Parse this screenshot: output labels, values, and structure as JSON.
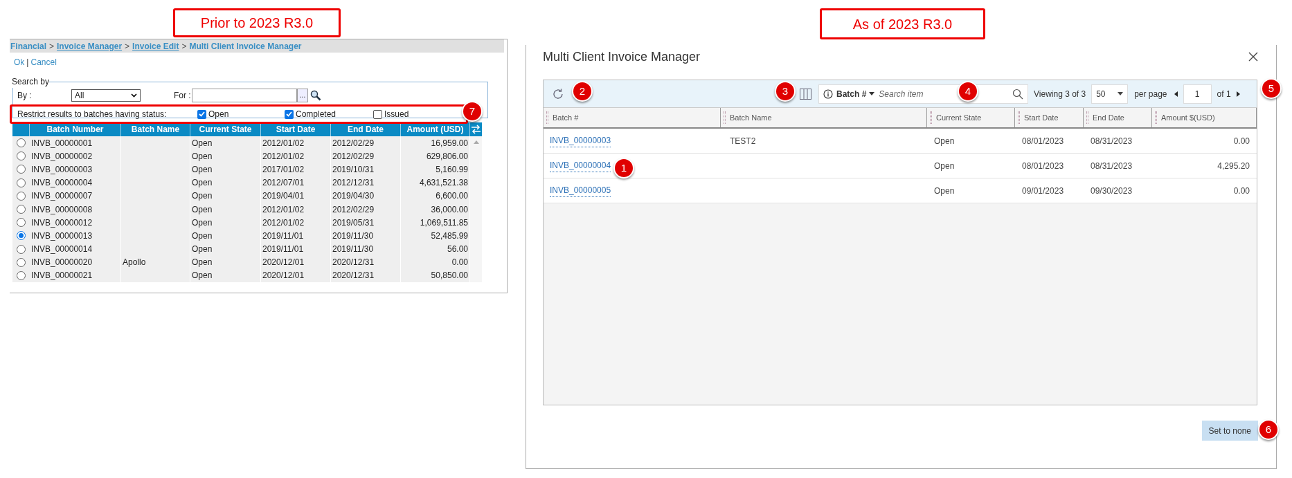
{
  "callouts": [
    {
      "label": "Prior to 2023 R3.0"
    },
    {
      "label": "As of 2023 R3.0"
    }
  ],
  "old_screen": {
    "breadcrumb": [
      {
        "kind": "crumb",
        "label": "Financial",
        "underlined": false
      },
      {
        "kind": "separator",
        "label": ">"
      },
      {
        "kind": "crumb",
        "label": "Invoice Manager",
        "underlined": true
      },
      {
        "kind": "separator",
        "label": ">"
      },
      {
        "kind": "crumb",
        "label": "Invoice Edit",
        "underlined": true
      },
      {
        "kind": "separator",
        "label": ">"
      },
      {
        "kind": "crumb",
        "label": "Multi Client Invoice Manager",
        "underlined": false
      }
    ],
    "actions": [
      {
        "kind": "link",
        "label": "Ok"
      },
      {
        "kind": "separator",
        "label": "|"
      },
      {
        "kind": "link",
        "label": "Cancel"
      }
    ],
    "search_by": {
      "legend": "Search by",
      "by_label": "By :",
      "by_value": "All",
      "for_label": "For :",
      "browse_button": "...",
      "status_label": "Restrict results to batches having status:",
      "statuses": [
        {
          "label": "Open",
          "checked": true
        },
        {
          "label": "Completed",
          "checked": true
        },
        {
          "label": "Issued",
          "checked": false
        }
      ]
    },
    "table": {
      "columns": [
        "Batch Number",
        "Batch Name",
        "Current State",
        "Start Date",
        "End Date",
        "Amount (USD)"
      ],
      "rows": [
        {
          "selected": false,
          "cells": [
            "INVB_00000001",
            "",
            "Open",
            "2012/01/02",
            "2012/02/29",
            "16,959.00"
          ]
        },
        {
          "selected": false,
          "cells": [
            "INVB_00000002",
            "",
            "Open",
            "2012/01/02",
            "2012/02/29",
            "629,806.00"
          ]
        },
        {
          "selected": false,
          "cells": [
            "INVB_00000003",
            "",
            "Open",
            "2017/01/02",
            "2019/10/31",
            "5,160.99"
          ]
        },
        {
          "selected": false,
          "cells": [
            "INVB_00000004",
            "",
            "Open",
            "2012/07/01",
            "2012/12/31",
            "4,631,521.38"
          ]
        },
        {
          "selected": false,
          "cells": [
            "INVB_00000007",
            "",
            "Open",
            "2019/04/01",
            "2019/04/30",
            "6,600.00"
          ]
        },
        {
          "selected": false,
          "cells": [
            "INVB_00000008",
            "",
            "Open",
            "2012/01/02",
            "2012/02/29",
            "36,000.00"
          ]
        },
        {
          "selected": false,
          "cells": [
            "INVB_00000012",
            "",
            "Open",
            "2012/01/02",
            "2019/05/31",
            "1,069,511.85"
          ]
        },
        {
          "selected": true,
          "cells": [
            "INVB_00000013",
            "",
            "Open",
            "2019/11/01",
            "2019/11/30",
            "52,485.99"
          ]
        },
        {
          "selected": false,
          "cells": [
            "INVB_00000014",
            "",
            "Open",
            "2019/11/01",
            "2019/11/30",
            "56.00"
          ]
        },
        {
          "selected": false,
          "cells": [
            "INVB_00000020",
            "Apollo",
            "Open",
            "2020/12/01",
            "2020/12/31",
            "0.00"
          ]
        },
        {
          "selected": false,
          "cells": [
            "INVB_00000021",
            "",
            "Open",
            "2020/12/01",
            "2020/12/31",
            "50,850.00"
          ]
        }
      ]
    }
  },
  "new_screen": {
    "title": "Multi Client Invoice Manager",
    "toolbar": {
      "filter_field": "Batch #",
      "search_placeholder": "Search item",
      "viewing": "Viewing 3 of 3",
      "per_page_value": "50",
      "per_page_label": "per page",
      "page": "1",
      "page_count": "of 1"
    },
    "table": {
      "columns": [
        "Batch #",
        "Batch Name",
        "Current State",
        "Start Date",
        "End Date",
        "Amount $(USD)"
      ],
      "rows": [
        {
          "cells": [
            "INVB_00000003",
            "TEST2",
            "Open",
            "08/01/2023",
            "08/31/2023",
            "0.00"
          ]
        },
        {
          "cells": [
            "INVB_00000004",
            "",
            "Open",
            "08/01/2023",
            "08/31/2023",
            "4,295.20"
          ]
        },
        {
          "cells": [
            "INVB_00000005",
            "",
            "Open",
            "09/01/2023",
            "09/30/2023",
            "0.00"
          ]
        }
      ]
    },
    "button": "Set to none"
  },
  "markers": [
    {
      "label": "1"
    },
    {
      "label": "2"
    },
    {
      "label": "3"
    },
    {
      "label": "4"
    },
    {
      "label": "5"
    },
    {
      "label": "6"
    },
    {
      "label": "7"
    }
  ]
}
